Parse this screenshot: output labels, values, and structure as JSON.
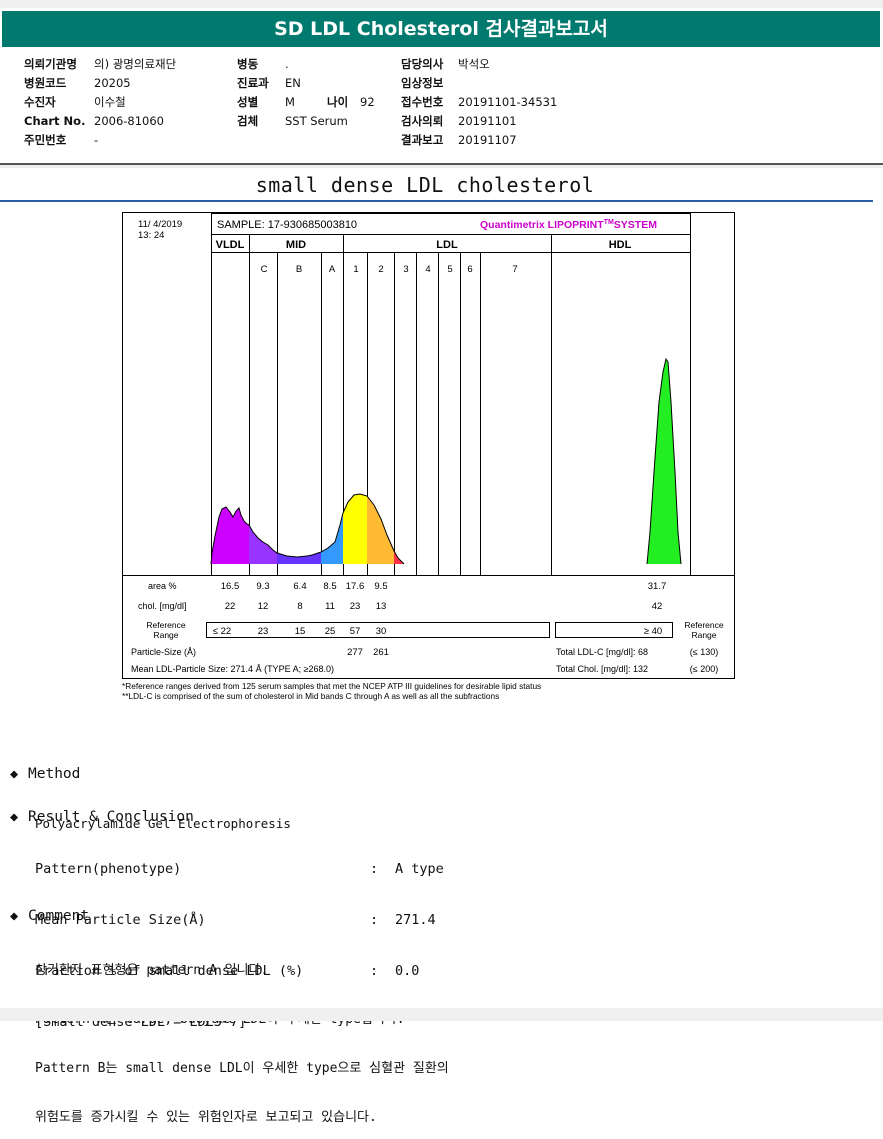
{
  "header": {
    "title": "SD LDL Cholesterol 검사결과보고서"
  },
  "patient": {
    "col1": [
      {
        "label": "의뢰기관명",
        "value": "의) 광명의료재단"
      },
      {
        "label": "병원코드",
        "value": "20205"
      },
      {
        "label": "수진자",
        "value": "이수철"
      },
      {
        "label": "Chart No.",
        "value": "2006-81060"
      },
      {
        "label": "주민번호",
        "value": "-"
      }
    ],
    "col2": [
      {
        "label": "병동",
        "value": "."
      },
      {
        "label": "진료과",
        "value": "EN"
      },
      {
        "label": "성별",
        "value": "M"
      },
      {
        "label": "검체",
        "value": "SST Serum"
      }
    ],
    "age": {
      "label": "나이",
      "value": "92"
    },
    "col3": [
      {
        "label": "담당의사",
        "value": "박석오"
      },
      {
        "label": "임상정보",
        "value": ""
      },
      {
        "label": "접수번호",
        "value": "20191101-34531"
      },
      {
        "label": "검사의뢰",
        "value": "20191101"
      },
      {
        "label": "결과보고",
        "value": "20191107"
      }
    ]
  },
  "section_title": "small dense LDL cholesterol",
  "chart": {
    "date": "11/ 4/2019",
    "time": "13: 24",
    "sample": "SAMPLE:  17-930685003810",
    "brand": "Quantimetrix LIPOPRINT",
    "brand_sup": "TM",
    "brand_tail": "SYSTEM",
    "groups": {
      "vldl": "VLDL",
      "mid": "MID",
      "ldl": "LDL",
      "hdl": "HDL"
    },
    "bands": [
      "C",
      "B",
      "A",
      "1",
      "2",
      "3",
      "4",
      "5",
      "6",
      "7"
    ],
    "area_label": "area %",
    "area_values": [
      "16.5",
      "9.3",
      "6.4",
      "8.5",
      "17.6",
      "9.5"
    ],
    "area_hdl": "31.7",
    "chol_label": "chol. [mg/dl]",
    "chol_values": [
      "22",
      "12",
      "8",
      "11",
      "23",
      "13"
    ],
    "chol_hdl": "42",
    "ref_label_1": "Reference",
    "ref_label_2": "Range",
    "ref_values": [
      "≤ 22",
      "23",
      "15",
      "25",
      "57",
      "30"
    ],
    "ref_hdl": "≥ 40",
    "ref_right_1": "Reference",
    "ref_right_2": "Range",
    "particle_label": "Particle-Size (Å)",
    "particle_values": [
      "277",
      "261"
    ],
    "total_ldl_label": "Total LDL-C [mg/dl]: 68",
    "total_ldl_range": "(≤ 130)",
    "mean_label": "Mean LDL-Particle Size:  271.4 Å   (TYPE A; ≥268.0)",
    "total_chol_label": "Total Chol. [mg/dl]:  132",
    "total_chol_range": "(≤ 200)",
    "footnote1": "*Reference ranges derived from 125 serum samples that met the NCEP ATP III guidelines for desirable lipid status",
    "footnote2": "**LDL-C is comprised of the sum of cholesterol in Mid bands C through A as well as all the subfractions"
  },
  "method": {
    "heading": "Method",
    "text": "Polyacrylamide Gel Electrophoresis"
  },
  "result": {
    "heading": "Result & Conclusion",
    "rows": [
      {
        "label": "Pattern(phenotype)",
        "value": "A type"
      },
      {
        "label": "Mean Particle Size(Å)",
        "value": "271.4"
      },
      {
        "label": "Fraction % of small dense LDL (%)",
        "value": "0.0"
      }
    ],
    "note": "[Small dense LDL = LDL3~7]",
    "colon": ":"
  },
  "comment": {
    "heading": "Comment",
    "lines": [
      "상기환자 표현형은 pattern A 입니다.",
      "Pattern A는 large, buoyant LDL이 우세한 type입니다.",
      "Pattern B는 small dense LDL이 우세한 type으로 심혈관 질환의",
      "위험도를 증가시킬 수 있는 위험인자로 보고되고 있습니다."
    ]
  },
  "colors": {
    "banner": "#007a6e",
    "vldl": "#cc00ff",
    "midc": "#9933ff",
    "midb": "#6633ff",
    "mida": "#3399ff",
    "ldl1": "#ffff00",
    "ldl2": "#ffbb33",
    "ldl3": "#ff3344",
    "hdl": "#22ee22",
    "brand": "#cc00cc"
  }
}
